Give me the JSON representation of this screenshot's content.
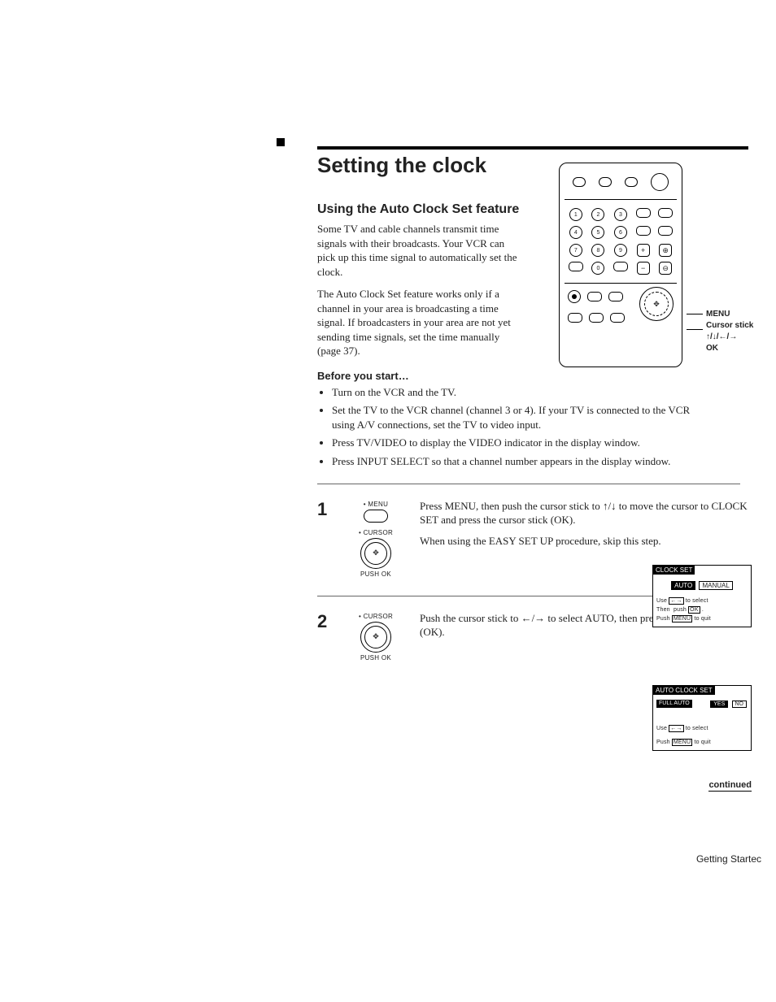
{
  "title": "Setting the clock",
  "section_heading": "Using the Auto Clock Set feature",
  "intro": {
    "p1": "Some TV and cable channels transmit time signals with their broadcasts. Your VCR can pick up this time signal to automatically set the clock.",
    "p2": "The Auto Clock Set feature works only if a channel in your area is broadcasting a time signal. If broadcasters in your area are not yet sending time signals, set the time manually (page 37)."
  },
  "before": {
    "heading": "Before you start…",
    "items": [
      "Turn on the VCR and the TV.",
      "Set the TV to the VCR channel (channel 3 or 4). If your TV is connected to the VCR using A/V connections, set the TV to video input.",
      "Press TV/VIDEO to display the VIDEO indicator in the display window.",
      "Press INPUT SELECT so that a channel number appears in the display window."
    ]
  },
  "steps": [
    {
      "num": "1",
      "icon": {
        "top_label": "• MENU",
        "mid_label": "• CURSOR",
        "bottom_label": "PUSH OK"
      },
      "text1": "Press MENU, then push the cursor stick to ↑/↓ to move the cursor to CLOCK SET and press the cursor stick (OK).",
      "text2": "When using the EASY SET UP procedure, skip this step."
    },
    {
      "num": "2",
      "icon": {
        "top_label": "• CURSOR",
        "bottom_label": "PUSH OK"
      },
      "text1": "Push the cursor stick to ←/→ to select AUTO, then press the cursor stick (OK)."
    }
  ],
  "remote": {
    "digits": [
      "1",
      "2",
      "3",
      "4",
      "5",
      "6",
      "7",
      "8",
      "9",
      "0"
    ],
    "legend": {
      "menu": "MENU",
      "cursor": "Cursor stick",
      "arrows": "↑/↓/←/→",
      "ok": "OK"
    }
  },
  "osd1": {
    "title": "CLOCK SET",
    "options": [
      "AUTO",
      "MANUAL"
    ],
    "hint1": "Use ←→ to select",
    "hint2": "Then  push OK .",
    "hint3": "Push MENU to quit"
  },
  "osd2": {
    "title": "AUTO CLOCK SET",
    "row_label": "FULL AUTO",
    "options": [
      "YES",
      "NO"
    ],
    "hint1": "Use ←→ to select",
    "hint3": "Push MENU to quit"
  },
  "continued": "continued",
  "footer": "Getting Startec"
}
